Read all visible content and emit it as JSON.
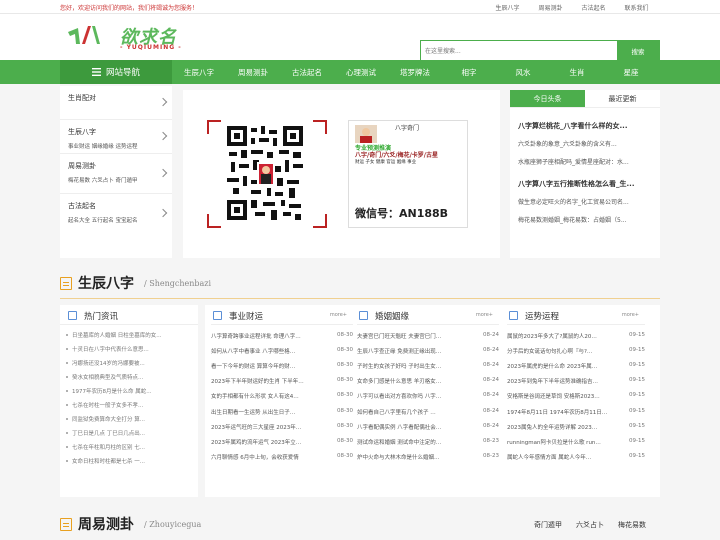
{
  "topbar": {
    "welcome": "您好，欢迎访问我们的网站，我们将竭诚为您服务！",
    "links": [
      "生辰八字",
      "周易测卦",
      "古法起名",
      "联系我们"
    ]
  },
  "logo": {
    "cn": "欲求名",
    "en": "- YUQIUMING -"
  },
  "search": {
    "placeholder": "在这里搜索...",
    "button": "搜索"
  },
  "nav": {
    "home": "网站导航",
    "items": [
      "生辰八字",
      "周易测卦",
      "古法起名",
      "心理测试",
      "塔罗牌法",
      "相字",
      "风水",
      "生肖",
      "星座"
    ]
  },
  "sidebar": [
    {
      "title": "生肖配对",
      "sub": ""
    },
    {
      "title": "生辰八字",
      "sub": "事业财运 姻缘婚缘 运势运程"
    },
    {
      "title": "周易测卦",
      "sub": "梅花易数 六爻占卜 奇门遁甲"
    },
    {
      "title": "古法起名",
      "sub": "起名大全 五行起名 宝宝起名"
    }
  ],
  "banner": {
    "card_title": "八字奇门",
    "card_tag": "专业预测推演",
    "card_services": "八字/奇门/六爻/梅花/卡罗/古星",
    "card_lines": "财运  子女  健康  官运  姻缘  事业",
    "wechat": "微信号：AN188B"
  },
  "news": {
    "tabs": [
      "今日头条",
      "最近更新"
    ],
    "items": [
      {
        "text": "八字算烂桃花_八字看什么样的女...",
        "bold": true
      },
      {
        "text": "六爻卦象的象意_六爻卦象的含义有...",
        "bold": false
      },
      {
        "text": "水瓶座狮子座相配吗_爱情星座配对：水...",
        "bold": false
      },
      {
        "text": "八字算八字五行推断性格怎么看_生...",
        "bold": true
      },
      {
        "text": "做生意必定旺火的名字_化工贸易公司名...",
        "bold": false
      },
      {
        "text": "梅花易数测婚姻_梅花易数：占婚姻（5...",
        "bold": false
      }
    ]
  },
  "section1": {
    "cn": "生辰八字",
    "en": "/ Shengchenbazi"
  },
  "section2": {
    "cn": "周易测卦",
    "en": "/ Zhouyicegua",
    "tabs": [
      "奇门遁甲",
      "六爻占卜",
      "梅花易数"
    ]
  },
  "hot": {
    "title": "热门资讯",
    "items": [
      "日坐墓库的人婚姻 日柱坐墓库的女...",
      "十灵日在八字中代表什么意思...",
      "冯娜扬还没14岁的冯娜要被...",
      "癸水女相貌典型及气质特点...",
      "1977年农历8月是什么命 属蛇...",
      "七杀在时柱一般子女多不孝...",
      "同监狱免费算命大全打分 算...",
      "丁巳日是几点 丁巳日几点出...",
      "七杀在年柱和月柱的区别 七...",
      "女命日柱和时柱都是七杀 一..."
    ]
  },
  "columns": [
    {
      "title": "事业财运",
      "more": "more+",
      "items": [
        {
          "t": "八字算奇跨事业运程详批 命理八字…",
          "d": "08-30"
        },
        {
          "t": "如何从八字中看事业 八字哪些格…",
          "d": "08-30"
        },
        {
          "t": "看一下今年的财运 算算今年的财…",
          "d": "08-30"
        },
        {
          "t": "2023年下半年财运好的生肖 下半年…",
          "d": "08-30"
        },
        {
          "t": "女的手相都有什么形状 女人有这4…",
          "d": "08-30"
        },
        {
          "t": "出生日期看一生运势 从出生日子…",
          "d": "08-30"
        },
        {
          "t": "2023年运气旺的三大星座 2023年…",
          "d": "08-30"
        },
        {
          "t": "2023年属鸡的流年运气 2023年立…",
          "d": "08-30"
        },
        {
          "t": "六月聊情感 6月中上旬，会收获爱情",
          "d": "08-30"
        }
      ]
    },
    {
      "title": "婚姻姻缘",
      "more": "more+",
      "items": [
        {
          "t": "夫妻宫巳门旺天魁旺 夫妻宫巳门…",
          "d": "08-24"
        },
        {
          "t": "生辰八字查正缘 免费测正缘出现…",
          "d": "08-24"
        },
        {
          "t": "子时生的女孩子好吗 子时出生女…",
          "d": "08-24"
        },
        {
          "t": "女命多门感是什么意思 羊刃格女…",
          "d": "08-24"
        },
        {
          "t": "八字可以看出对方喜欢你吗 八字…",
          "d": "08-24"
        },
        {
          "t": "如何看自己八字里有几个孩子 …",
          "d": "08-24"
        },
        {
          "t": "八字看配偶实例 八字看配偶社会…",
          "d": "08-24"
        },
        {
          "t": "测试命运和婚姻 测试命中注定的…",
          "d": "08-23"
        },
        {
          "t": "炉中火命与大林木命是什么婚姻…",
          "d": "08-23"
        }
      ]
    },
    {
      "title": "运势运程",
      "more": "more+",
      "items": [
        {
          "t": "属鼠的2023年多大了?属鼠的人20…",
          "d": "09-15"
        },
        {
          "t": "分手后的女诞话句句扎心啊『与?…",
          "d": "09-15"
        },
        {
          "t": "2023年属虎的是什么命 2023年属…",
          "d": "09-15"
        },
        {
          "t": "2023年到兔年下半年运势准确指吉…",
          "d": "09-15"
        },
        {
          "t": "安格斯是谷阔还是草饲 安格斯2023…",
          "d": "09-15"
        },
        {
          "t": "1974年8月11日 1974年农历8月11日…",
          "d": "09-15"
        },
        {
          "t": "2023属兔人的全年运势详解 2023…",
          "d": "09-15"
        },
        {
          "t": "runningman阿卡贝拉是什么歌 run…",
          "d": "09-15"
        },
        {
          "t": "属蛇人今年感情方面 属蛇人今年…",
          "d": "09-15"
        }
      ]
    }
  ],
  "colors": {
    "green": "#4cae4c",
    "dark_green": "#3d9a3d",
    "accent": "#e8a020"
  }
}
